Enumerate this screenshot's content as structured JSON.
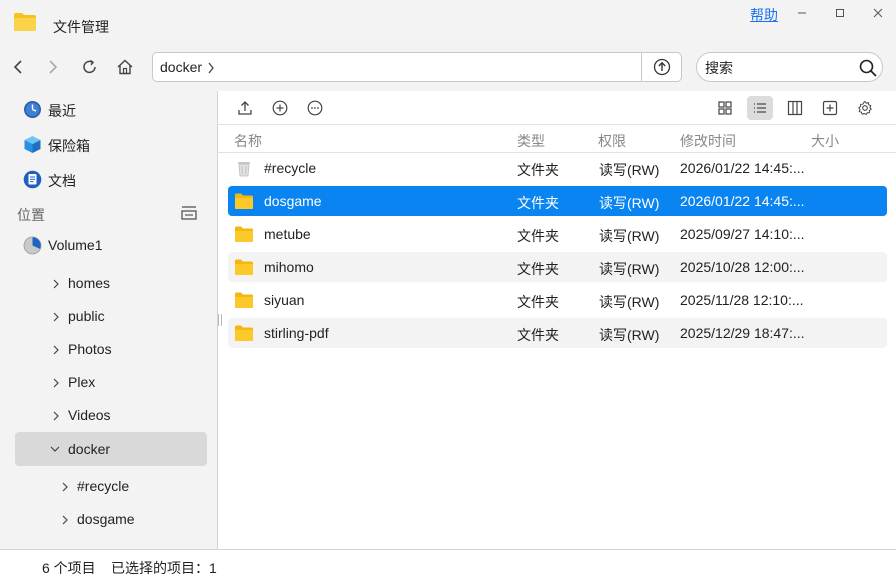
{
  "window": {
    "title": "文件管理",
    "help_label": "帮助"
  },
  "navbar": {
    "path": "docker",
    "search_placeholder": "搜索"
  },
  "sidebar": {
    "quick": [
      {
        "label": "最近",
        "icon": "clock-icon"
      },
      {
        "label": "保险箱",
        "icon": "vault-cube-icon"
      },
      {
        "label": "文档",
        "icon": "document-icon"
      }
    ],
    "section_label": "位置",
    "volume": "Volume1",
    "tree": [
      "homes",
      "public",
      "Photos",
      "Plex",
      "Videos",
      "docker"
    ],
    "subtree": [
      "#recycle",
      "dosgame"
    ]
  },
  "columns": {
    "name": "名称",
    "type": "类型",
    "permission": "权限",
    "modified": "修改时间",
    "size": "大小"
  },
  "files": [
    {
      "name": "#recycle",
      "type": "文件夹",
      "permission": "读写(RW)",
      "modified": "2026/01/22 14:45:...",
      "icon": "recycle-bin-icon"
    },
    {
      "name": "dosgame",
      "type": "文件夹",
      "permission": "读写(RW)",
      "modified": "2026/01/22 14:45:...",
      "icon": "folder-icon"
    },
    {
      "name": "metube",
      "type": "文件夹",
      "permission": "读写(RW)",
      "modified": "2025/09/27 14:10:...",
      "icon": "folder-icon"
    },
    {
      "name": "mihomo",
      "type": "文件夹",
      "permission": "读写(RW)",
      "modified": "2025/10/28 12:00:...",
      "icon": "folder-icon"
    },
    {
      "name": "siyuan",
      "type": "文件夹",
      "permission": "读写(RW)",
      "modified": "2025/11/28 12:10:...",
      "icon": "folder-icon"
    },
    {
      "name": "stirling-pdf",
      "type": "文件夹",
      "permission": "读写(RW)",
      "modified": "2025/12/29 18:47:...",
      "icon": "folder-icon"
    }
  ],
  "status": {
    "count": "6 个项目",
    "selected": "已选择的项目：1"
  },
  "colors": {
    "accent": "#0a84f0",
    "folder": "#f7c21d",
    "link": "#1a73e8",
    "chrome_bg": "#f3f3f3"
  }
}
